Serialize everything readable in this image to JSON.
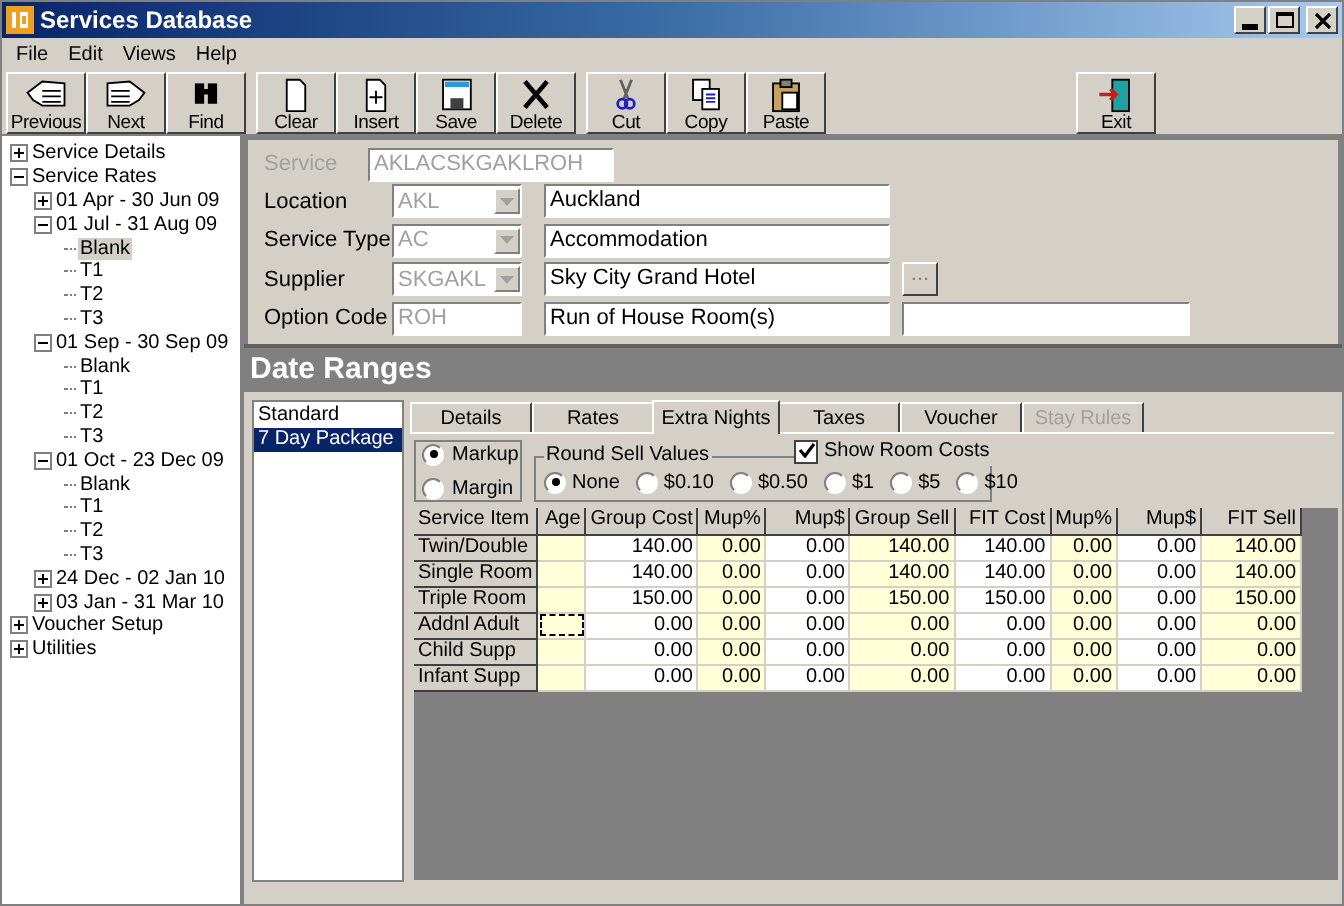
{
  "window": {
    "title": "Services Database"
  },
  "menu": [
    "File",
    "Edit",
    "Views",
    "Help"
  ],
  "toolbar": [
    [
      "Previous",
      "Next",
      "Find"
    ],
    [
      "Clear",
      "Insert",
      "Save",
      "Delete"
    ],
    [
      "Cut",
      "Copy",
      "Paste"
    ],
    [
      "Exit"
    ]
  ],
  "tree": [
    {
      "label": "Service Details",
      "expanded": false,
      "selected": false
    },
    {
      "label": "Service Rates",
      "expanded": true,
      "selected": false,
      "children": [
        {
          "label": "01 Apr - 30 Jun 09",
          "expanded": false,
          "selected": false
        },
        {
          "label": "01 Jul - 31 Aug 09",
          "expanded": true,
          "selected": false,
          "children": [
            {
              "label": "Blank",
              "selected": true
            },
            {
              "label": "T1",
              "selected": false
            },
            {
              "label": "T2",
              "selected": false
            },
            {
              "label": "T3",
              "selected": false
            }
          ]
        },
        {
          "label": "01 Sep - 30 Sep 09",
          "expanded": true,
          "selected": false,
          "children": [
            {
              "label": "Blank",
              "selected": false
            },
            {
              "label": "T1",
              "selected": false
            },
            {
              "label": "T2",
              "selected": false
            },
            {
              "label": "T3",
              "selected": false
            }
          ]
        },
        {
          "label": "01 Oct - 23 Dec 09",
          "expanded": true,
          "selected": false,
          "children": [
            {
              "label": "Blank",
              "selected": false
            },
            {
              "label": "T1",
              "selected": false
            },
            {
              "label": "T2",
              "selected": false
            },
            {
              "label": "T3",
              "selected": false
            }
          ]
        },
        {
          "label": "24 Dec - 02 Jan 10",
          "expanded": false,
          "selected": false
        },
        {
          "label": "03 Jan - 31 Mar 10",
          "expanded": false,
          "selected": false
        }
      ]
    },
    {
      "label": "Voucher Setup",
      "expanded": false,
      "selected": false
    },
    {
      "label": "Utilities",
      "expanded": false,
      "selected": false
    }
  ],
  "service": {
    "label": "Service",
    "value": "AKLACSKGAKLROH",
    "disabled": true
  },
  "form_rows": [
    {
      "label": "Location",
      "kind": "combo",
      "code": "AKL",
      "name": "Auckland"
    },
    {
      "label": "Service Type",
      "kind": "combo",
      "code": "AC",
      "name": "Accommodation"
    },
    {
      "label": "Supplier",
      "kind": "combo-browse",
      "code": "SKGAKL",
      "name": "Sky City Grand Hotel",
      "button": "..."
    },
    {
      "label": "Option Code",
      "kind": "text-extra",
      "code": "ROH",
      "name": "Run of House Room(s)"
    }
  ],
  "section_title": "Date Ranges",
  "date_ranges": [
    {
      "label": "Standard",
      "selected": false
    },
    {
      "label": "7 Day Package",
      "selected": true
    }
  ],
  "tabs": [
    {
      "label": "Details",
      "selected": false,
      "disabled": false
    },
    {
      "label": "Rates",
      "selected": false,
      "disabled": false
    },
    {
      "label": "Extra Nights",
      "selected": true,
      "disabled": false
    },
    {
      "label": "Taxes",
      "selected": false,
      "disabled": false
    },
    {
      "label": "Voucher",
      "selected": false,
      "disabled": false
    },
    {
      "label": "Stay Rules",
      "selected": false,
      "disabled": true
    }
  ],
  "calc_mode": [
    {
      "label": "Markup",
      "selected": true
    },
    {
      "label": "Margin",
      "selected": false
    }
  ],
  "round_sell": {
    "title": "Round Sell Values",
    "options": [
      {
        "label": "None",
        "selected": true
      },
      {
        "label": "$0.10",
        "selected": false
      },
      {
        "label": "$0.50",
        "selected": false
      },
      {
        "label": "$1",
        "selected": false
      },
      {
        "label": "$5",
        "selected": false
      },
      {
        "label": "$10",
        "selected": false
      }
    ]
  },
  "show_room_costs": {
    "label": "Show Room Costs",
    "checked": true
  },
  "grid": {
    "columns": [
      {
        "label": "Service Item"
      },
      {
        "label": "Age",
        "shaded": true
      },
      {
        "label": "Group Cost",
        "shaded": false
      },
      {
        "label": "Mup%",
        "shaded": true
      },
      {
        "label": "Mup$",
        "shaded": false
      },
      {
        "label": "Group Sell",
        "shaded": true
      },
      {
        "label": "FIT Cost",
        "shaded": false
      },
      {
        "label": "Mup%",
        "shaded": true
      },
      {
        "label": "Mup$",
        "shaded": false
      },
      {
        "label": "FIT Sell",
        "shaded": true
      }
    ],
    "rows": [
      {
        "focused": false,
        "cells": [
          "Twin/Double",
          "",
          "140.00",
          "0.00",
          "0.00",
          "140.00",
          "140.00",
          "0.00",
          "0.00",
          "140.00"
        ]
      },
      {
        "focused": false,
        "cells": [
          "Single Room",
          "",
          "140.00",
          "0.00",
          "0.00",
          "140.00",
          "140.00",
          "0.00",
          "0.00",
          "140.00"
        ]
      },
      {
        "focused": false,
        "cells": [
          "Triple Room",
          "",
          "150.00",
          "0.00",
          "0.00",
          "150.00",
          "150.00",
          "0.00",
          "0.00",
          "150.00"
        ]
      },
      {
        "focused": true,
        "cells": [
          "Addnl Adult",
          "",
          "0.00",
          "0.00",
          "0.00",
          "0.00",
          "0.00",
          "0.00",
          "0.00",
          "0.00"
        ]
      },
      {
        "focused": false,
        "cells": [
          "Child Supp",
          "",
          "0.00",
          "0.00",
          "0.00",
          "0.00",
          "0.00",
          "0.00",
          "0.00",
          "0.00"
        ]
      },
      {
        "focused": false,
        "cells": [
          "Infant Supp",
          "",
          "0.00",
          "0.00",
          "0.00",
          "0.00",
          "0.00",
          "0.00",
          "0.00",
          "0.00"
        ]
      }
    ]
  }
}
